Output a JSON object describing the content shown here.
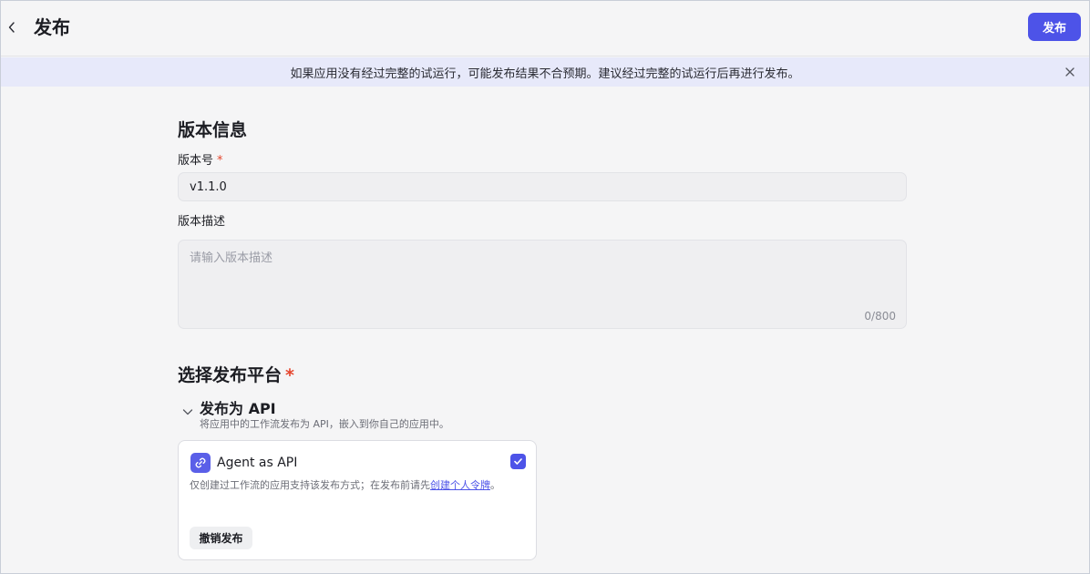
{
  "header": {
    "title": "发布",
    "publish_label": "发布"
  },
  "notice": {
    "text": "如果应用没有经过完整的试运行，可能发布结果不合预期。建议经过完整的试运行后再进行发布。"
  },
  "version_info": {
    "section_title": "版本信息",
    "version_label": "版本号",
    "required_mark": "*",
    "version_value": "v1.1.0",
    "description_label": "版本描述",
    "description_placeholder": "请输入版本描述",
    "char_count": "0/800"
  },
  "platform": {
    "section_title": "选择发布平台",
    "required_mark": "*",
    "api_group": {
      "title": "发布为 API",
      "description": "将应用中的工作流发布为 API，嵌入到你自己的应用中。"
    },
    "card": {
      "title": "Agent as API",
      "checked": true,
      "description_prefix": "仅创建过工作流的应用支持该发布方式；在发布前请先",
      "link_text": "创建个人令牌",
      "description_suffix": "。",
      "unpublish_label": "撤销发布"
    }
  },
  "icons": [
    "back-arrow-icon",
    "close-icon",
    "chevron-down-icon",
    "link-icon",
    "checkmark-icon"
  ],
  "colors": {
    "accent": "#4d53e8",
    "notice_bg": "#e7e9fa",
    "required": "#e5462e",
    "page_bg": "#f5f5f6"
  }
}
